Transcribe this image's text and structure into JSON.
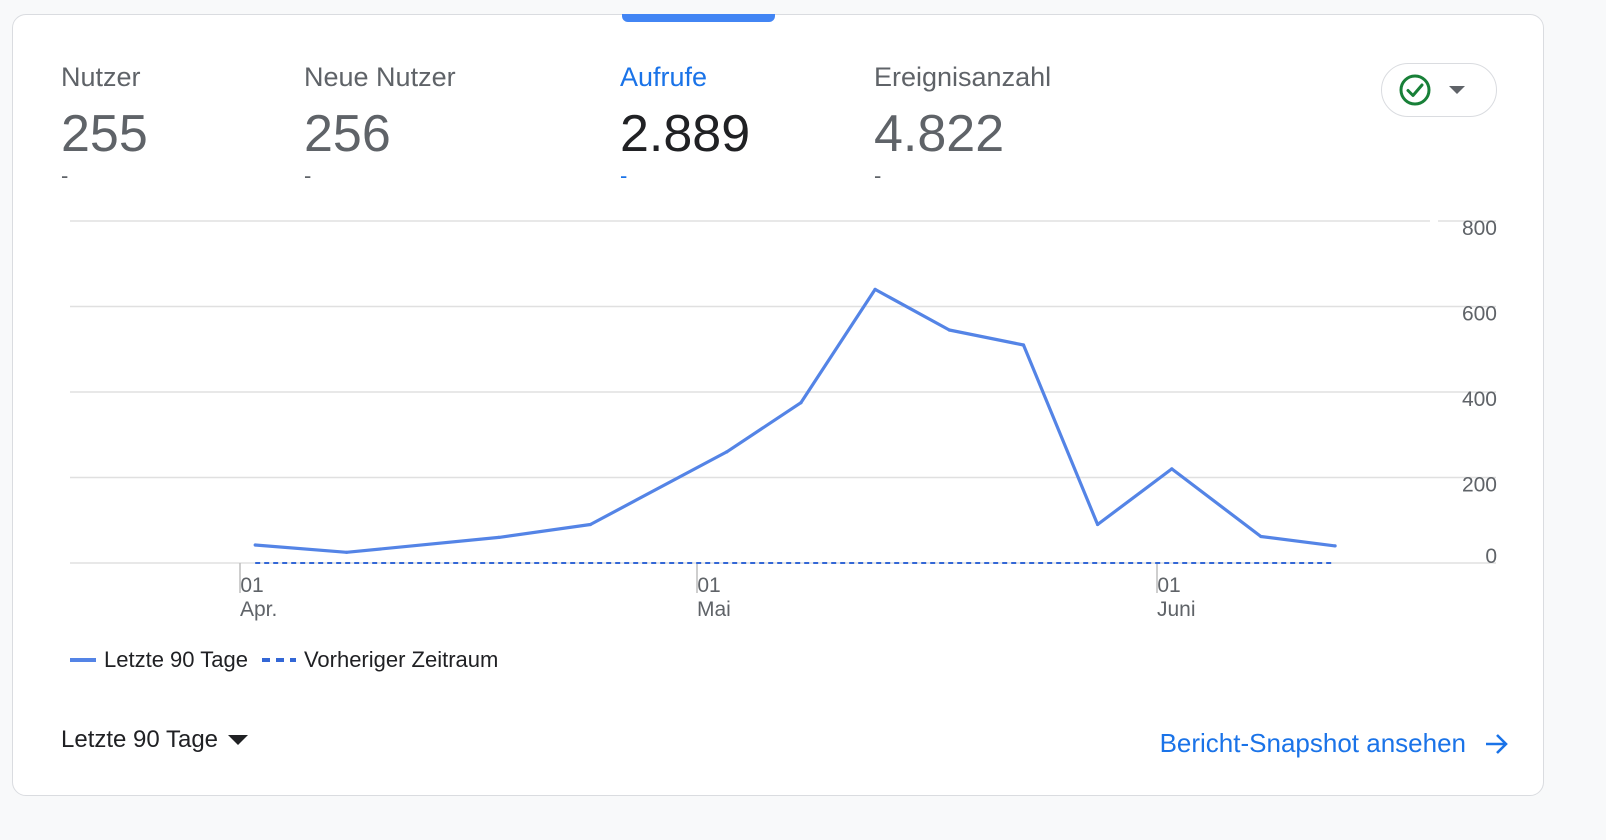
{
  "metrics": [
    {
      "label": "Nutzer",
      "value": "255",
      "delta": "-",
      "active": false
    },
    {
      "label": "Neue Nutzer",
      "value": "256",
      "delta": "-",
      "active": false
    },
    {
      "label": "Aufrufe",
      "value": "2.889",
      "delta": "-",
      "active": true
    },
    {
      "label": "Ereignisanzahl",
      "value": "4.822",
      "delta": "-",
      "active": false
    }
  ],
  "status_button": {
    "icon": "check-circle-icon",
    "dropdown_icon": "caret-down-icon",
    "color": "#188038"
  },
  "chart_data": {
    "type": "line",
    "x_ticks": [
      {
        "day": "01",
        "month": "Apr."
      },
      {
        "day": "01",
        "month": "Mai"
      },
      {
        "day": "01",
        "month": "Juni"
      }
    ],
    "y_ticks": [
      "800",
      "600",
      "400",
      "200",
      "0"
    ],
    "ylim": [
      0,
      800
    ],
    "series": [
      {
        "name": "Letzte 90 Tage",
        "style": "solid",
        "color": "#5484e6",
        "x": [
          "2024-04-02",
          "2024-04-08",
          "2024-04-18",
          "2024-04-24",
          "2024-05-03",
          "2024-05-08",
          "2024-05-13",
          "2024-05-18",
          "2024-05-23",
          "2024-05-28",
          "2024-06-02",
          "2024-06-08",
          "2024-06-13"
        ],
        "values": [
          42,
          25,
          60,
          90,
          260,
          375,
          640,
          545,
          510,
          90,
          220,
          62,
          40
        ]
      },
      {
        "name": "Vorheriger Zeitraum",
        "style": "dashed",
        "color": "#3367d6",
        "x": [
          "2024-04-02",
          "2024-06-13"
        ],
        "values": [
          0,
          0
        ]
      }
    ],
    "grid": true
  },
  "legend": [
    {
      "label": "Letzte 90 Tage",
      "style": "solid",
      "color": "#5484e6"
    },
    {
      "label": "Vorheriger Zeitraum",
      "style": "dashed",
      "color": "#3367d6"
    }
  ],
  "footer": {
    "range_label": "Letzte 90 Tage",
    "report_link": "Bericht-Snapshot ansehen",
    "report_icon": "arrow-right-icon"
  }
}
